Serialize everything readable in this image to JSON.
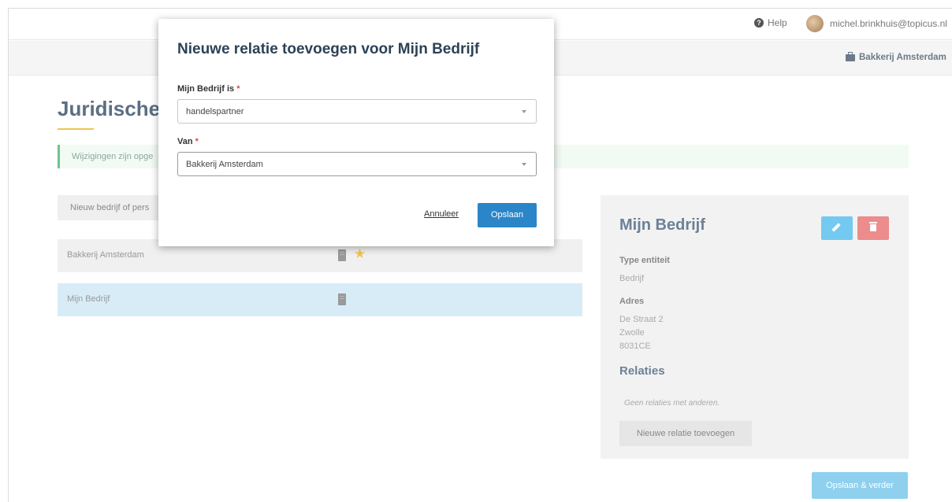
{
  "header": {
    "help_label": "Help",
    "user_email": "michel.brinkhuis@topicus.nl",
    "company_switch": "Bakkerij Amsterdam"
  },
  "page": {
    "title": "Juridische",
    "alert": "Wijzigingen zijn opge",
    "new_entity_button": "Nieuw bedrijf of pers"
  },
  "entities": [
    {
      "name": "Bakkerij Amsterdam",
      "favorite": true,
      "selected": false
    },
    {
      "name": "Mijn Bedrijf",
      "favorite": false,
      "selected": true
    }
  ],
  "detail": {
    "title": "Mijn Bedrijf",
    "type_label": "Type entiteit",
    "type_value": "Bedrijf",
    "address_label": "Adres",
    "address_lines": [
      "De Straat 2",
      "Zwolle",
      "8031CE"
    ],
    "relations_heading": "Relaties",
    "relations_empty": "Geen relaties met anderen.",
    "new_relation_button": "Nieuwe relatie toevoegen"
  },
  "footer": {
    "save_next_button": "Opslaan & verder"
  },
  "modal": {
    "title": "Nieuwe relatie toevoegen voor Mijn Bedrijf",
    "field1_label": "Mijn Bedrijf is",
    "field1_value": "handelspartner",
    "field2_label": "Van",
    "field2_value": "Bakkerij Amsterdam",
    "required_mark": "*",
    "cancel_label": "Annuleer",
    "save_label": "Opslaan"
  },
  "colors": {
    "primary": "#2a86c8",
    "edit": "#74c9f0",
    "delete": "#ec8c8c",
    "accent": "#f0c64e",
    "success": "#6cc48a"
  }
}
